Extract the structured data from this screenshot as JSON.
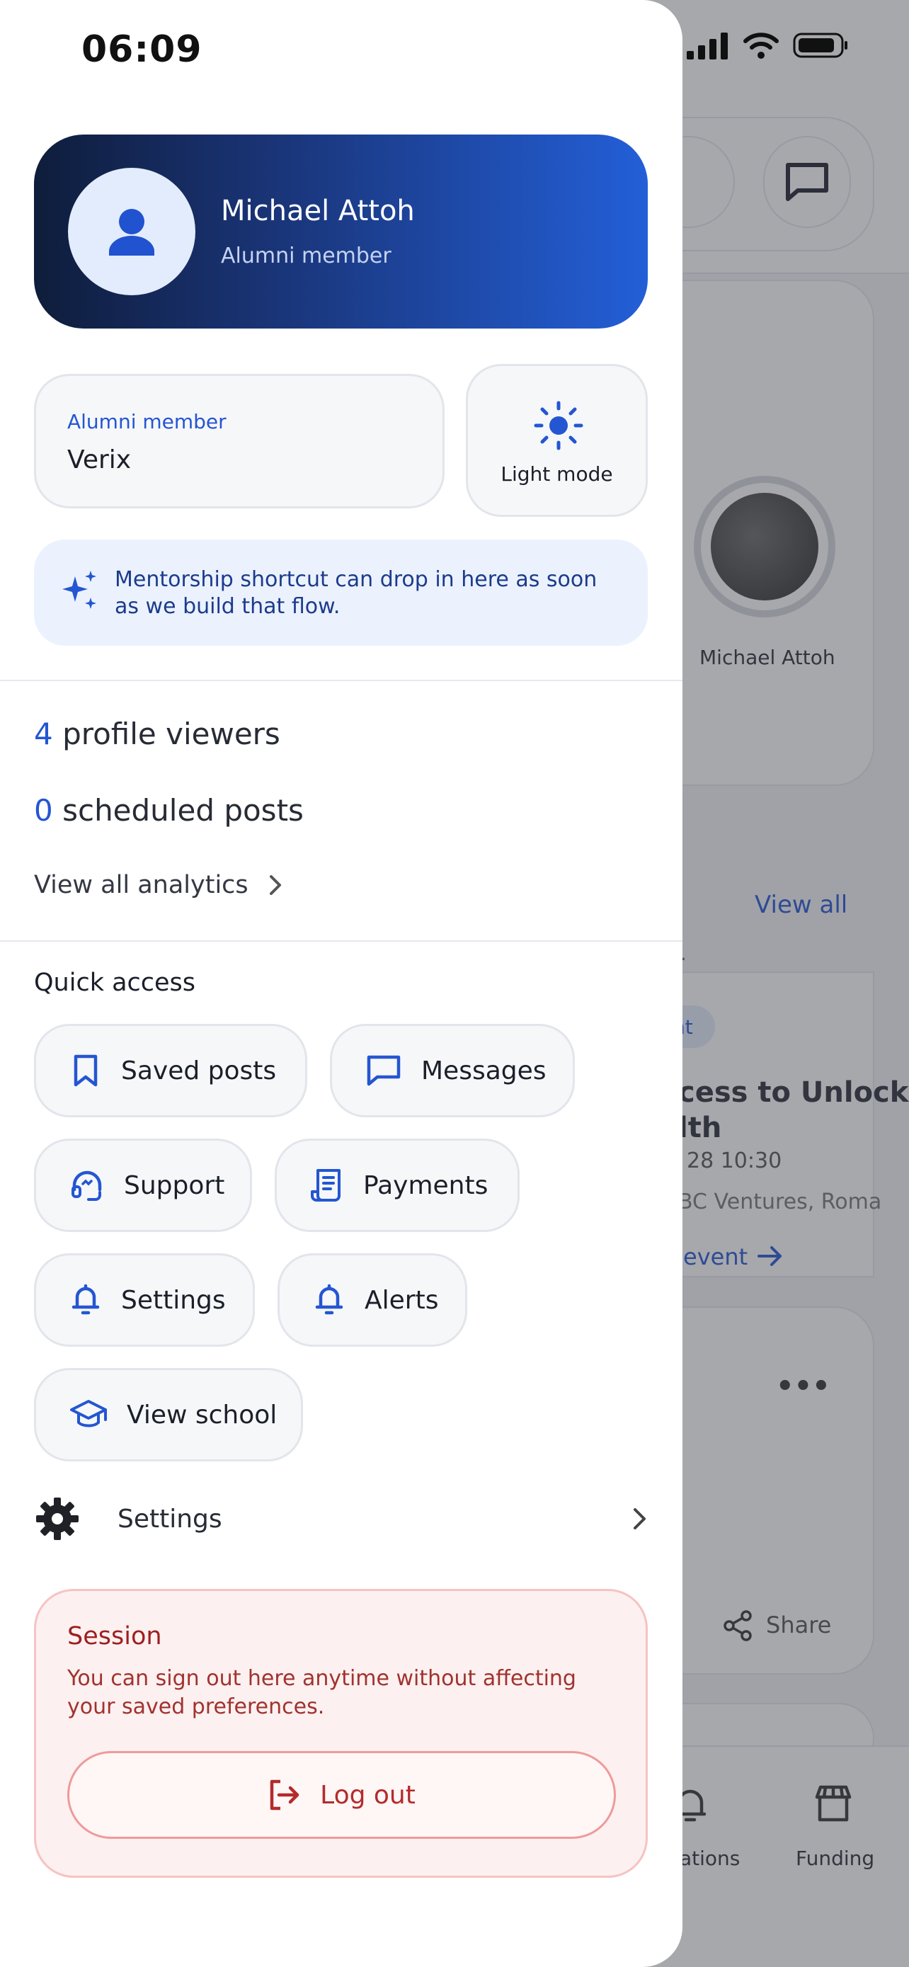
{
  "status_bar": {
    "time": "06:09"
  },
  "profile": {
    "name": "Michael Attoh",
    "role": "Alumni member"
  },
  "membership": {
    "label": "Alumni member",
    "value": "Verix"
  },
  "theme_toggle": {
    "label": "Light mode"
  },
  "tip": {
    "text": "Mentorship shortcut can drop in here as soon as we build that flow."
  },
  "stats": [
    {
      "value": "4",
      "label": "profile viewers"
    },
    {
      "value": "0",
      "label": "scheduled posts"
    }
  ],
  "analytics_link": "View all analytics",
  "quick_access": {
    "title": "Quick access",
    "items": [
      {
        "label": "Saved posts",
        "icon": "bookmark-icon"
      },
      {
        "label": "Messages",
        "icon": "message-icon"
      },
      {
        "label": "Support",
        "icon": "headset-icon"
      },
      {
        "label": "Payments",
        "icon": "receipt-icon"
      },
      {
        "label": "Settings",
        "icon": "bell-icon"
      },
      {
        "label": "Alerts",
        "icon": "bell-icon"
      },
      {
        "label": "View school",
        "icon": "graduation-cap-icon"
      }
    ]
  },
  "settings_row": {
    "label": "Settings"
  },
  "session": {
    "title": "Session",
    "text": "You can sign out here anytime without affecting your saved preferences.",
    "button": "Log out"
  },
  "background": {
    "profile_name": "Michael Attoh",
    "view_all": "View all",
    "event_title_line1": "cess to Unlock",
    "event_title_line2": "lth",
    "event_date": "28 10:30",
    "event_org": "BC Ventures, Roma",
    "event_link": "event",
    "tag": "nt",
    "snippet": "t.",
    "share": "Share",
    "nav_items": [
      "ations",
      "Funding"
    ]
  },
  "colors": {
    "accent": "#2456d2",
    "danger": "#b42b2b",
    "gradient_start": "#0f1d3b",
    "gradient_end": "#235fd8"
  }
}
